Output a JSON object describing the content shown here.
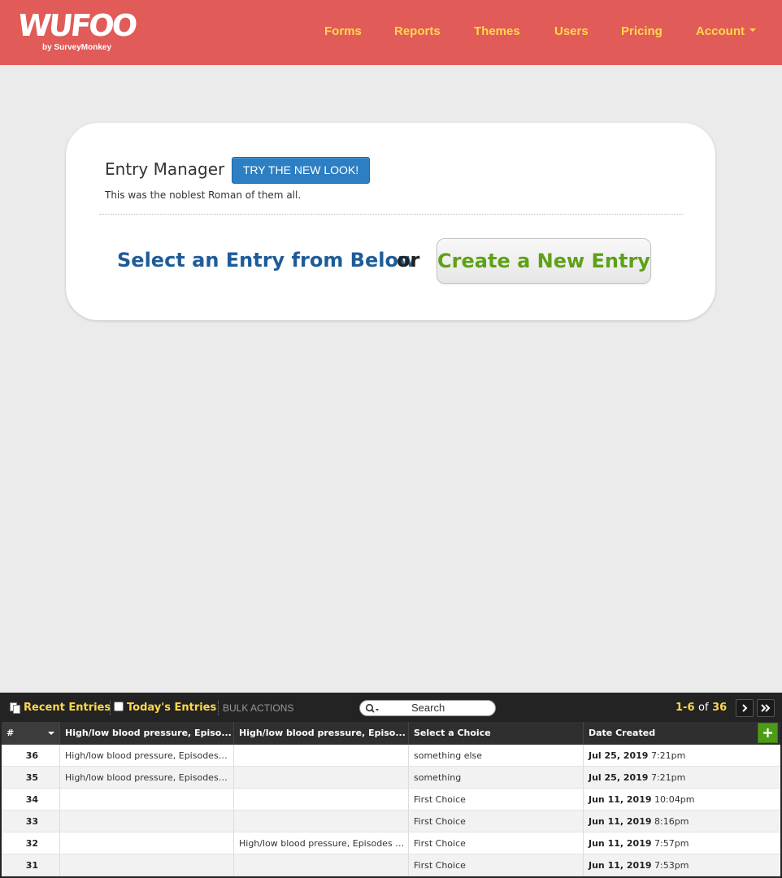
{
  "header": {
    "logo_text": "WUFOO",
    "logo_sub": "by SurveyMonkey",
    "nav": [
      "Forms",
      "Reports",
      "Themes",
      "Users",
      "Pricing",
      "Account"
    ],
    "brand_color": "#e15b58",
    "nav_color": "#ffd84a"
  },
  "card": {
    "title": "Entry Manager",
    "try_button": "TRY THE NEW LOOK!",
    "description": "This was the noblest Roman of them all.",
    "select_text": "Select an Entry from Below",
    "or_text": "or",
    "create_button": "Create a New Entry"
  },
  "toolbar": {
    "recent": "Recent Entries",
    "today": "Today's Entries",
    "bulk": "BULK ACTIONS",
    "search_placeholder": "Search",
    "range": "1-6",
    "of": "of",
    "total": "36",
    "next_icon": "›",
    "last_icon": "»"
  },
  "table": {
    "columns": [
      "#",
      "High/low blood pressure, Episo...",
      "High/low blood pressure, Episo...",
      "Select a Choice",
      "Date Created"
    ],
    "add_column_icon": "+",
    "rows": [
      {
        "num": "36",
        "c1": "High/low blood pressure, Episodes of dizziness",
        "c2": "",
        "c3": "something else",
        "date": "Jul 25, 2019",
        "time": "7:21pm"
      },
      {
        "num": "35",
        "c1": "High/low blood pressure, Episodes of dizziness",
        "c2": "",
        "c3": "something",
        "date": "Jul 25, 2019",
        "time": "7:21pm"
      },
      {
        "num": "34",
        "c1": "",
        "c2": "",
        "c3": "First Choice",
        "date": "Jun 11, 2019",
        "time": "10:04pm"
      },
      {
        "num": "33",
        "c1": "",
        "c2": "",
        "c3": "First Choice",
        "date": "Jun 11, 2019",
        "time": "8:16pm"
      },
      {
        "num": "32",
        "c1": "",
        "c2": "High/low blood pressure, Episodes of dizziness",
        "c3": "First Choice",
        "date": "Jun 11, 2019",
        "time": "7:57pm"
      },
      {
        "num": "31",
        "c1": "",
        "c2": "",
        "c3": "First Choice",
        "date": "Jun 11, 2019",
        "time": "7:53pm"
      }
    ]
  }
}
